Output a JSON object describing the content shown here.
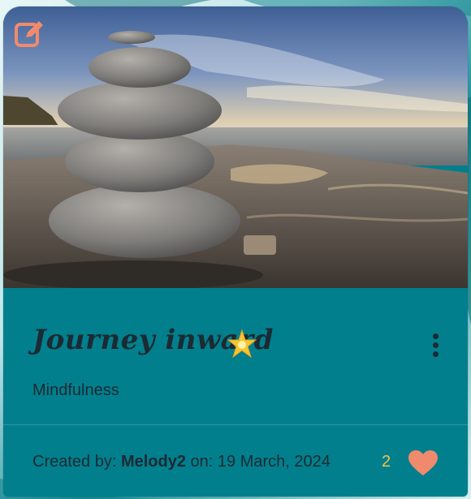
{
  "card": {
    "title": "Journey inward",
    "category": "Mindfulness",
    "created_by_label": "Created by:",
    "author": "Melody2",
    "on_label": "on:",
    "date": "19 March, 2024",
    "likes": "2"
  },
  "icons": {
    "edit": "edit-icon",
    "sparkle": "sparkle-star-icon",
    "menu": "kebab-menu-icon",
    "like": "heart-icon"
  },
  "colors": {
    "card_bg": "#027f8d",
    "accent": "#f08a6e",
    "text": "#1b2a33",
    "likes_count": "#f2c34b"
  }
}
